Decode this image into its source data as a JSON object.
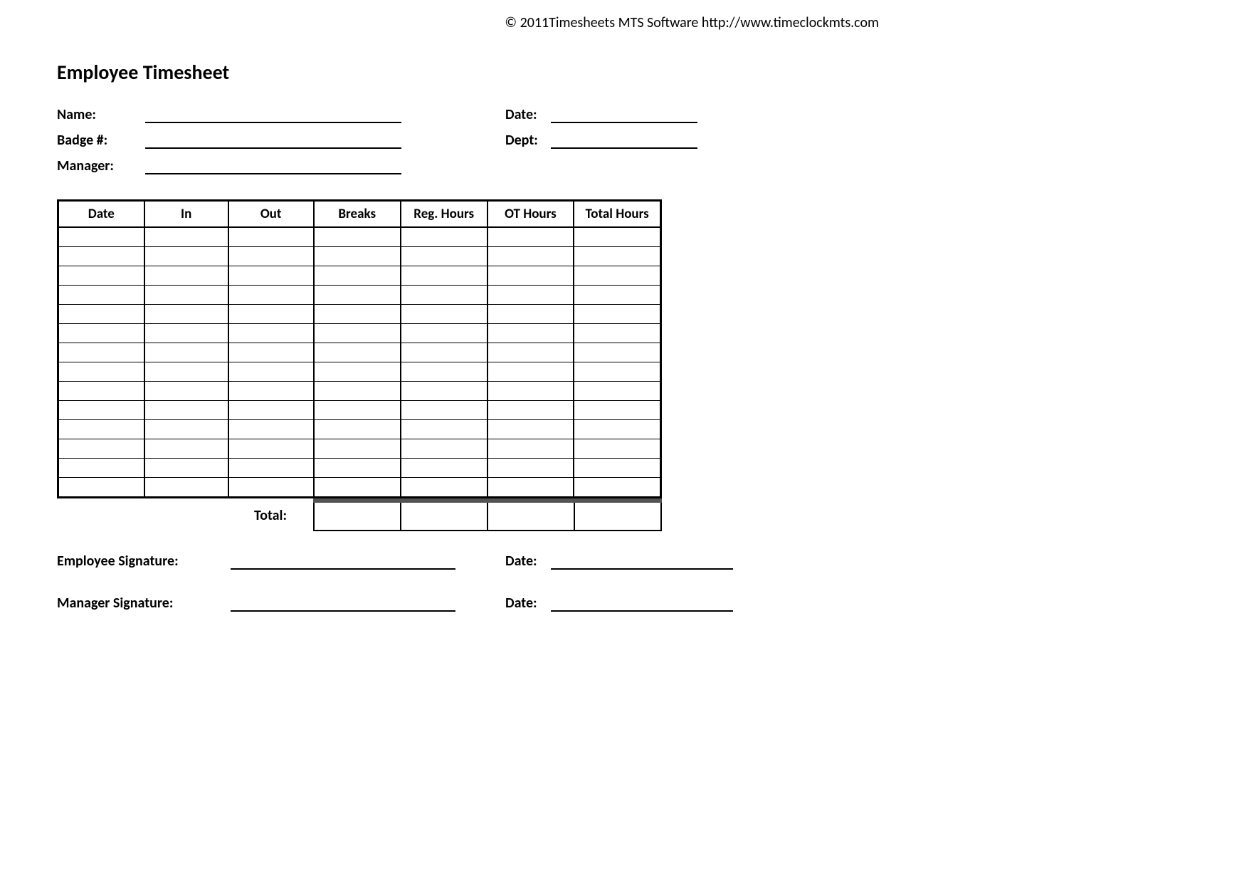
{
  "copyright": "© 2011Timesheets MTS Software  http://www.timeclockmts.com",
  "title": "Employee Timesheet",
  "fields": {
    "name_label": "Name:",
    "badge_label": "Badge #:",
    "manager_label": "Manager:",
    "date_label": "Date:",
    "dept_label": "Dept:"
  },
  "table": {
    "columns": [
      "Date",
      "In",
      "Out",
      "Breaks",
      "Reg. Hours",
      "OT Hours",
      "Total Hours"
    ],
    "row_count": 14,
    "total_label": "Total:"
  },
  "signatures": {
    "employee_label": "Employee Signature:",
    "manager_label": "Manager Signature:",
    "date_label": "Date:"
  }
}
